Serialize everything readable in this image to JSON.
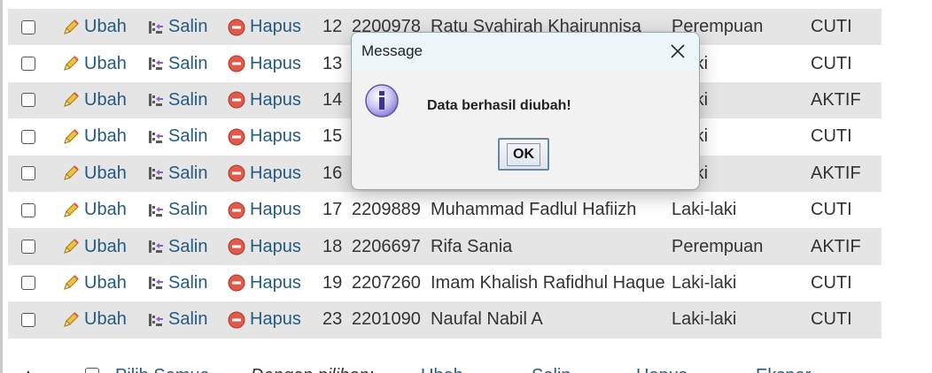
{
  "table": {
    "actions": {
      "edit": "Ubah",
      "copy": "Salin",
      "delete": "Hapus"
    },
    "rows": [
      {
        "id": "12",
        "nim": "2200978",
        "name": "Ratu Syahirah Khairunnisa",
        "gender": "Perempuan",
        "status": "CUTI"
      },
      {
        "id": "13",
        "nim": "",
        "name": "",
        "gender": "i-laki",
        "status": "CUTI"
      },
      {
        "id": "14",
        "nim": "",
        "name": "",
        "gender": "i-laki",
        "status": "AKTIF"
      },
      {
        "id": "15",
        "nim": "",
        "name": "",
        "gender": "i-laki",
        "status": "CUTI"
      },
      {
        "id": "16",
        "nim": "",
        "name": "",
        "gender": "i-laki",
        "status": "AKTIF"
      },
      {
        "id": "17",
        "nim": "2209889",
        "name": "Muhammad Fadlul Hafiizh",
        "gender": "Laki-laki",
        "status": "CUTI"
      },
      {
        "id": "18",
        "nim": "2206697",
        "name": "Rifa Sania",
        "gender": "Perempuan",
        "status": "AKTIF"
      },
      {
        "id": "19",
        "nim": "2207260",
        "name": "Imam Khalish Rafidhul Haque",
        "gender": "Laki-laki",
        "status": "CUTI"
      },
      {
        "id": "23",
        "nim": "2201090",
        "name": "Naufal Nabil A",
        "gender": "Laki-laki",
        "status": "CUTI"
      }
    ]
  },
  "bottom_bar": {
    "check_all": "Pilih Semua",
    "with_selected": "Dengan pilihan:",
    "edit": "Ubah",
    "copy": "Salin",
    "delete": "Hapus",
    "export": "Ekspor"
  },
  "dialog": {
    "title": "Message",
    "message": "Data berhasil diubah!",
    "ok_label": "OK"
  },
  "colors": {
    "link": "#235a81",
    "row_alt": "#e5e5e5",
    "dialog_title_bg": "#eaf6f7"
  },
  "icons": {
    "edit": "pencil-icon",
    "copy": "copy-icon",
    "delete": "delete-icon",
    "info": "info-icon",
    "close": "close-icon"
  }
}
